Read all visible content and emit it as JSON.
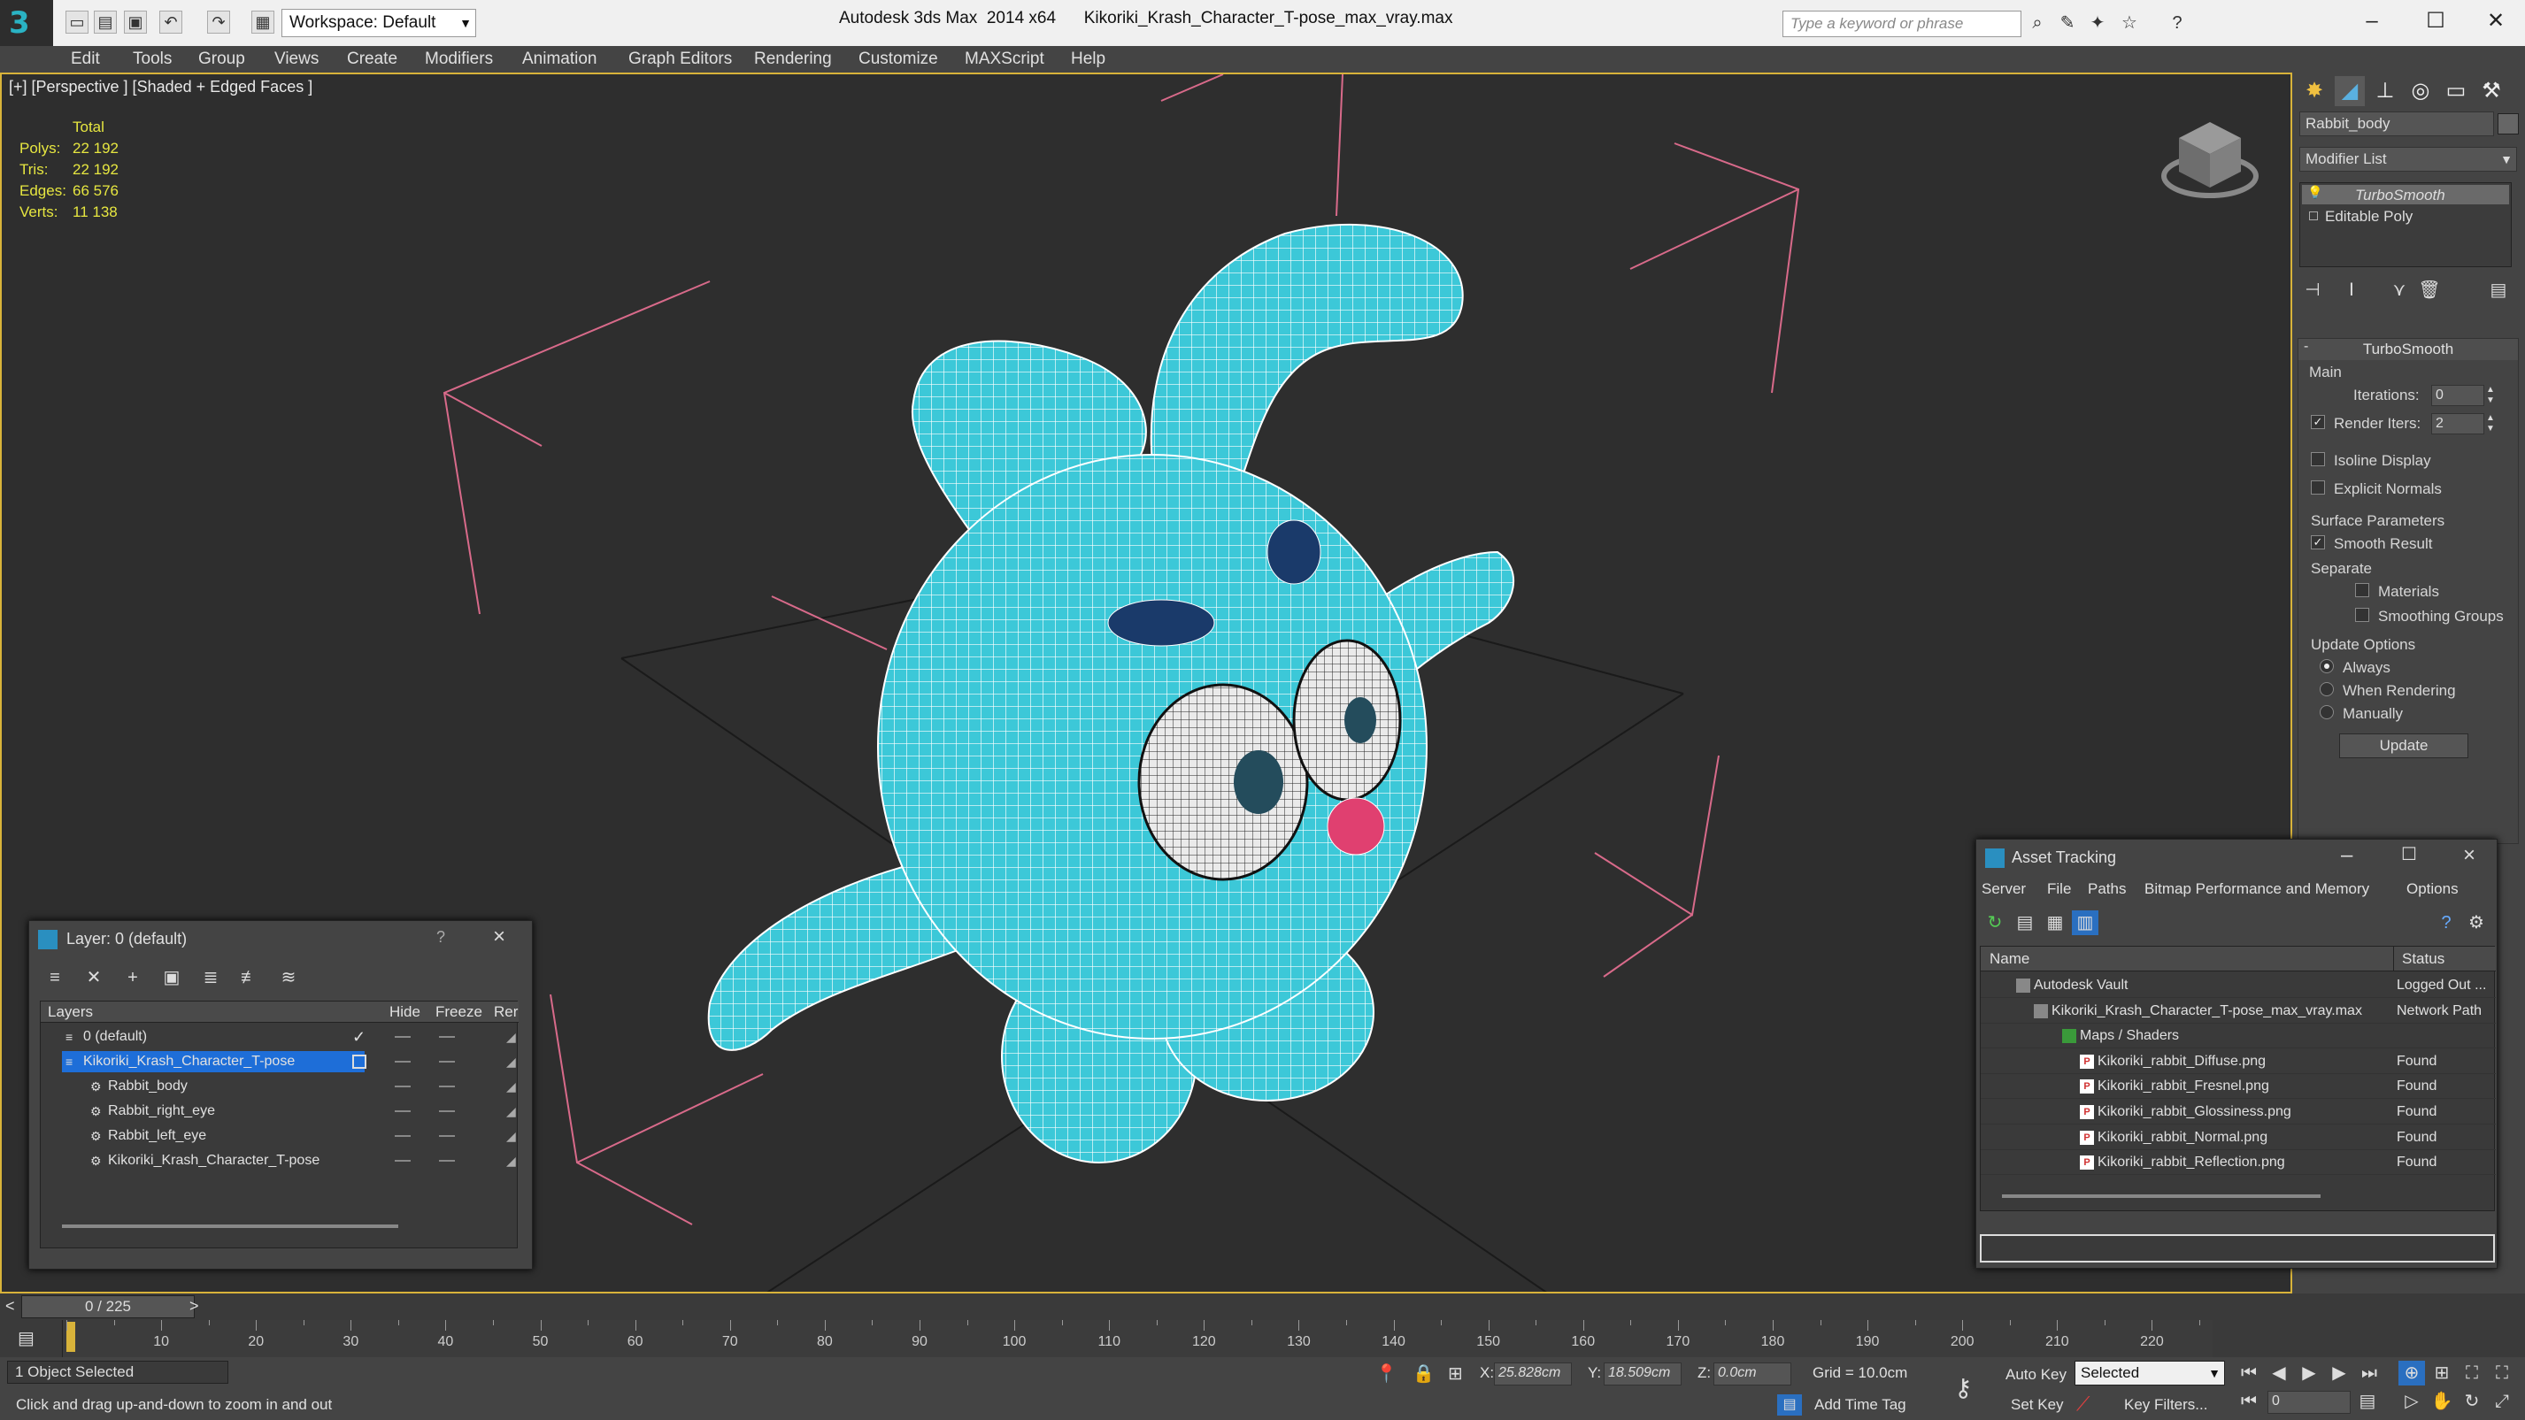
{
  "titlebar": {
    "workspace": "Workspace: Default",
    "title": "Autodesk 3ds Max  2014 x64      Kikoriki_Krash_Character_T-pose_max_vray.max",
    "search_placeholder": "Type a keyword or phrase"
  },
  "menu": [
    "Edit",
    "Tools",
    "Group",
    "Views",
    "Create",
    "Modifiers",
    "Animation",
    "Graph Editors",
    "Rendering",
    "Customize",
    "MAXScript",
    "Help"
  ],
  "viewport": {
    "label": "[+] [Perspective ] [Shaded + Edged Faces ]",
    "stats": {
      "header": "Total",
      "rows": [
        {
          "label": "Polys:",
          "value": "22 192"
        },
        {
          "label": "Tris:",
          "value": "22 192"
        },
        {
          "label": "Edges:",
          "value": "66 576"
        },
        {
          "label": "Verts:",
          "value": "11 138"
        }
      ]
    }
  },
  "command_panel": {
    "object_name": "Rabbit_body",
    "modifier_list": "Modifier List",
    "stack": [
      "TurboSmooth",
      "Editable Poly"
    ],
    "rollout_title": "TurboSmooth",
    "main_group": "Main",
    "iterations_label": "Iterations:",
    "iterations_value": "0",
    "render_iters_label": "Render Iters:",
    "render_iters_value": "2",
    "isoline_display": "Isoline Display",
    "explicit_normals": "Explicit Normals",
    "surface_params": "Surface Parameters",
    "smooth_result": "Smooth Result",
    "separate": "Separate",
    "materials": "Materials",
    "smoothing_groups": "Smoothing Groups",
    "update_options": "Update Options",
    "always": "Always",
    "when_rendering": "When Rendering",
    "manually": "Manually",
    "update_button": "Update"
  },
  "layer_dialog": {
    "title": "Layer: 0 (default)",
    "help": "?",
    "columns": {
      "layers": "Layers",
      "hide": "Hide",
      "freeze": "Freeze",
      "render": "Rer"
    },
    "rows": [
      {
        "name": "0 (default)",
        "indent": 0,
        "selected": false
      },
      {
        "name": "Kikoriki_Krash_Character_T-pose",
        "indent": 0,
        "selected": true
      },
      {
        "name": "Rabbit_body",
        "indent": 1,
        "selected": false
      },
      {
        "name": "Rabbit_right_eye",
        "indent": 1,
        "selected": false
      },
      {
        "name": "Rabbit_left_eye",
        "indent": 1,
        "selected": false
      },
      {
        "name": "Kikoriki_Krash_Character_T-pose",
        "indent": 1,
        "selected": false
      }
    ]
  },
  "asset_dialog": {
    "title": "Asset Tracking",
    "menu": [
      "Server",
      "File",
      "Paths",
      "Bitmap Performance and Memory",
      "Options"
    ],
    "columns": {
      "name": "Name",
      "status": "Status"
    },
    "rows": [
      {
        "name": "Autodesk Vault",
        "status": "Logged Out ...",
        "indent": 1
      },
      {
        "name": "Kikoriki_Krash_Character_T-pose_max_vray.max",
        "status": "Network Path",
        "indent": 2
      },
      {
        "name": "Maps / Shaders",
        "status": "",
        "indent": 3
      },
      {
        "name": "Kikoriki_rabbit_Diffuse.png",
        "status": "Found",
        "indent": 4
      },
      {
        "name": "Kikoriki_rabbit_Fresnel.png",
        "status": "Found",
        "indent": 4
      },
      {
        "name": "Kikoriki_rabbit_Glossiness.png",
        "status": "Found",
        "indent": 4
      },
      {
        "name": "Kikoriki_rabbit_Normal.png",
        "status": "Found",
        "indent": 4
      },
      {
        "name": "Kikoriki_rabbit_Reflection.png",
        "status": "Found",
        "indent": 4
      }
    ]
  },
  "timeline": {
    "frame": "0 / 225",
    "ticks": [
      "10",
      "20",
      "30",
      "40",
      "50",
      "60",
      "70",
      "80",
      "90",
      "100",
      "110",
      "120",
      "130",
      "140",
      "150",
      "160",
      "170",
      "180",
      "190",
      "200",
      "210",
      "220"
    ]
  },
  "status": {
    "selected": "1 Object Selected",
    "hint": "Click and drag up-and-down to zoom in and out",
    "x_label": "X:",
    "x_value": "25.828cm",
    "y_label": "Y:",
    "y_value": "18.509cm",
    "z_label": "Z:",
    "z_value": "0.0cm",
    "grid": "Grid = 10.0cm",
    "add_time_tag": "Add Time Tag",
    "auto_key": "Auto Key",
    "set_key": "Set Key",
    "selected_dropdown": "Selected",
    "key_filters": "Key Filters...",
    "frame_value": "0"
  },
  "colors": {
    "mesh": "#3cc8d8",
    "wire": "#ffffff",
    "viewport_border": "#d8b33a",
    "selection": "#1e6ed8",
    "stats_text": "#e6e640",
    "lights": "#d86a8a"
  }
}
